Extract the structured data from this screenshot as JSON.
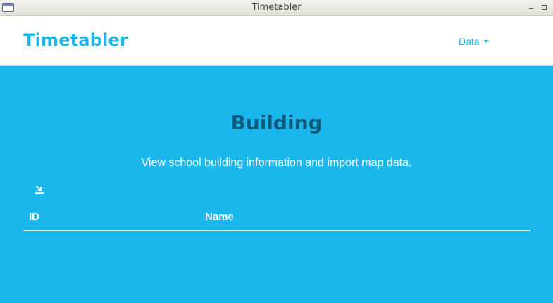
{
  "window": {
    "title": "Timetabler"
  },
  "header": {
    "brand": "Timetabler",
    "nav": {
      "data_label": "Data"
    }
  },
  "main": {
    "title": "Building",
    "subtitle": "View school building information and import map data.",
    "import_icon": "import-map-icon",
    "table": {
      "columns": [
        "ID",
        "Name"
      ],
      "rows": []
    }
  },
  "colors": {
    "accent": "#1bb7ec",
    "title_dark": "#0d5a7d",
    "header_bg": "#ffffff"
  }
}
